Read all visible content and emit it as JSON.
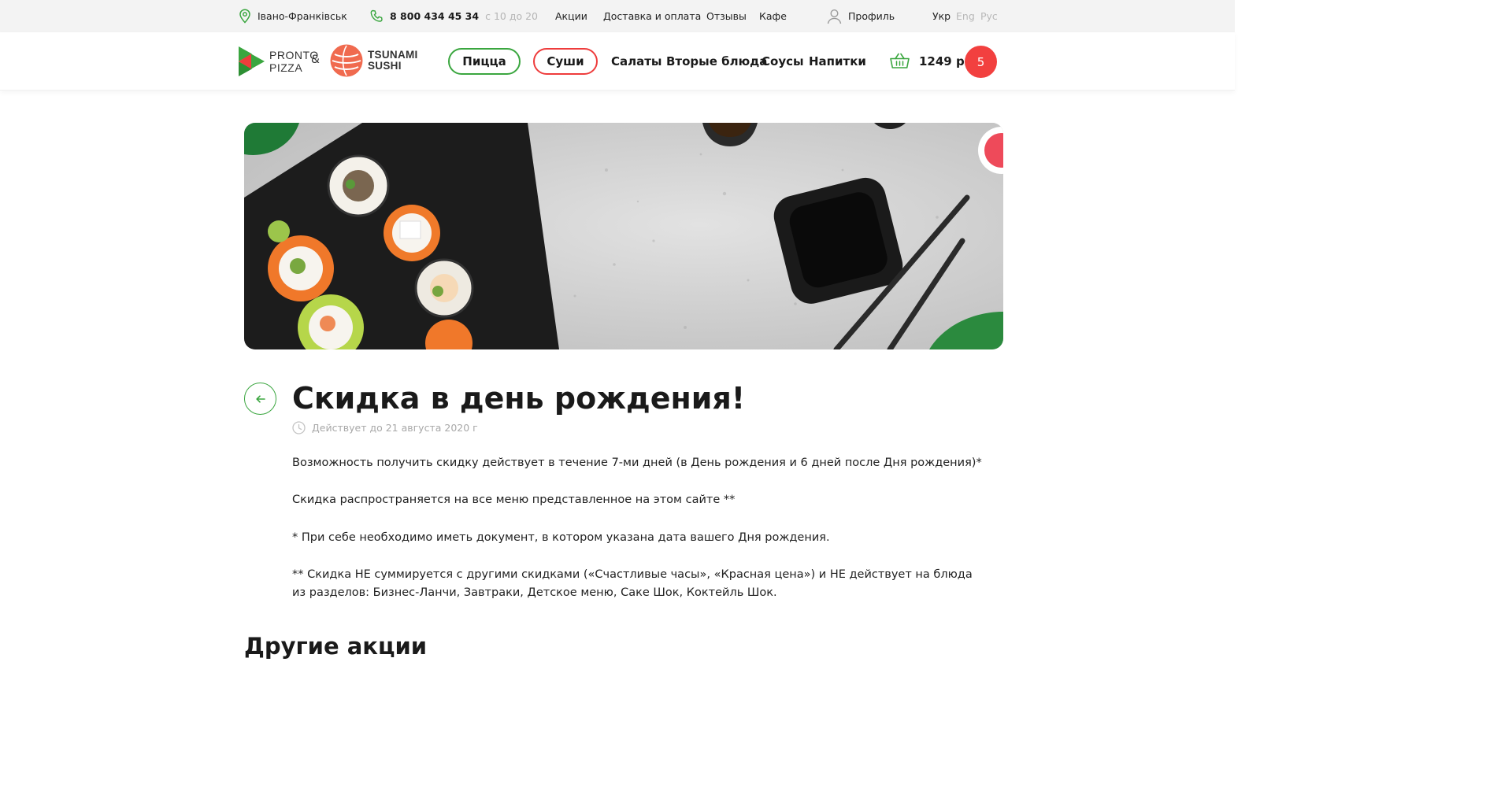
{
  "topbar": {
    "city": "Івано-Франківськ",
    "phone": "8 800 434 45 34",
    "hours": "с 10 до 20",
    "nav": [
      "Акции",
      "Доставка и оплата",
      "Отзывы",
      "Кафе"
    ],
    "profile": "Профиль",
    "languages": [
      "Укр",
      "Eng",
      "Рус"
    ],
    "active_language": "Укр"
  },
  "header": {
    "logo_pronto": [
      "PRONTO",
      "PIZZA"
    ],
    "amp": "&",
    "logo_tsunami": [
      "TSUNAMI",
      "SUSHI"
    ],
    "categories": [
      "Пицца",
      "Суши",
      "Салаты",
      "Вторые блюда",
      "Соусы",
      "Напитки"
    ],
    "cart_sum": "1249 р",
    "cart_count": "5"
  },
  "colors": {
    "green": "#3aa63f",
    "red": "#ee3c3c",
    "cart_badge": "#f2403f",
    "muted": "#a8a8a8"
  },
  "article": {
    "title": "Скидка в день рождения!",
    "valid_until": "Действует до 21 августа 2020 г",
    "paragraphs": [
      "Возможность получить скидку действует в течение 7-ми дней (в День рождения и 6 дней после Дня рождения)*",
      "Скидка распространяется на все меню представленное на этом сайте **",
      "* При себе необходимо иметь документ, в котором указана дата вашего Дня рождения.",
      "** Скидка НЕ суммируется с другими скидками («Счастливые часы», «Красная цена») и НЕ действует на блюда из разделов: Бизнес-Ланчи, Завтраки, Детское меню, Саке Шок, Коктейль Шок."
    ],
    "other_heading": "Другие акции"
  },
  "icons": {
    "city": "location-pin-icon",
    "phone": "phone-icon",
    "profile": "user-icon",
    "cart": "basket-icon",
    "back": "arrow-left-icon",
    "valid": "clock-icon"
  }
}
